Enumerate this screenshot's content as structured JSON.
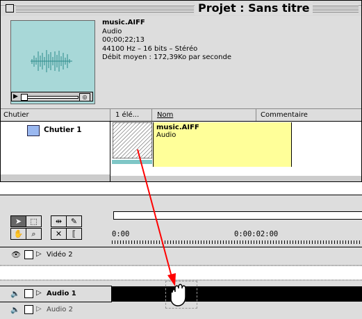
{
  "window": {
    "title": "Projet : Sans titre"
  },
  "preview": {
    "filename": "music.AIFF",
    "type": "Audio",
    "timecode": "00;00;22;13",
    "format": "44100 Hz – 16 bits – Stéréo",
    "rate": "Débit moyen : 172,39Ko par seconde"
  },
  "columns": {
    "bin": "Chutier",
    "count": "1 élé...",
    "name": "Nom",
    "comment": "Commentaire"
  },
  "bins": [
    {
      "label": "Chutier 1"
    }
  ],
  "clip": {
    "name": "music.AIFF",
    "type": "Audio"
  },
  "timeline": {
    "ruler_start": "0:00",
    "ruler_mark": "0:00:02:00",
    "tracks": [
      {
        "label": "Vidéo 2"
      },
      {
        "label": "Audio 1"
      },
      {
        "label": "Audio 2"
      }
    ]
  },
  "colors": {
    "thumb": "#a8d8d8",
    "clip_yellow": "#ffff99",
    "arrow": "#ff0000"
  }
}
